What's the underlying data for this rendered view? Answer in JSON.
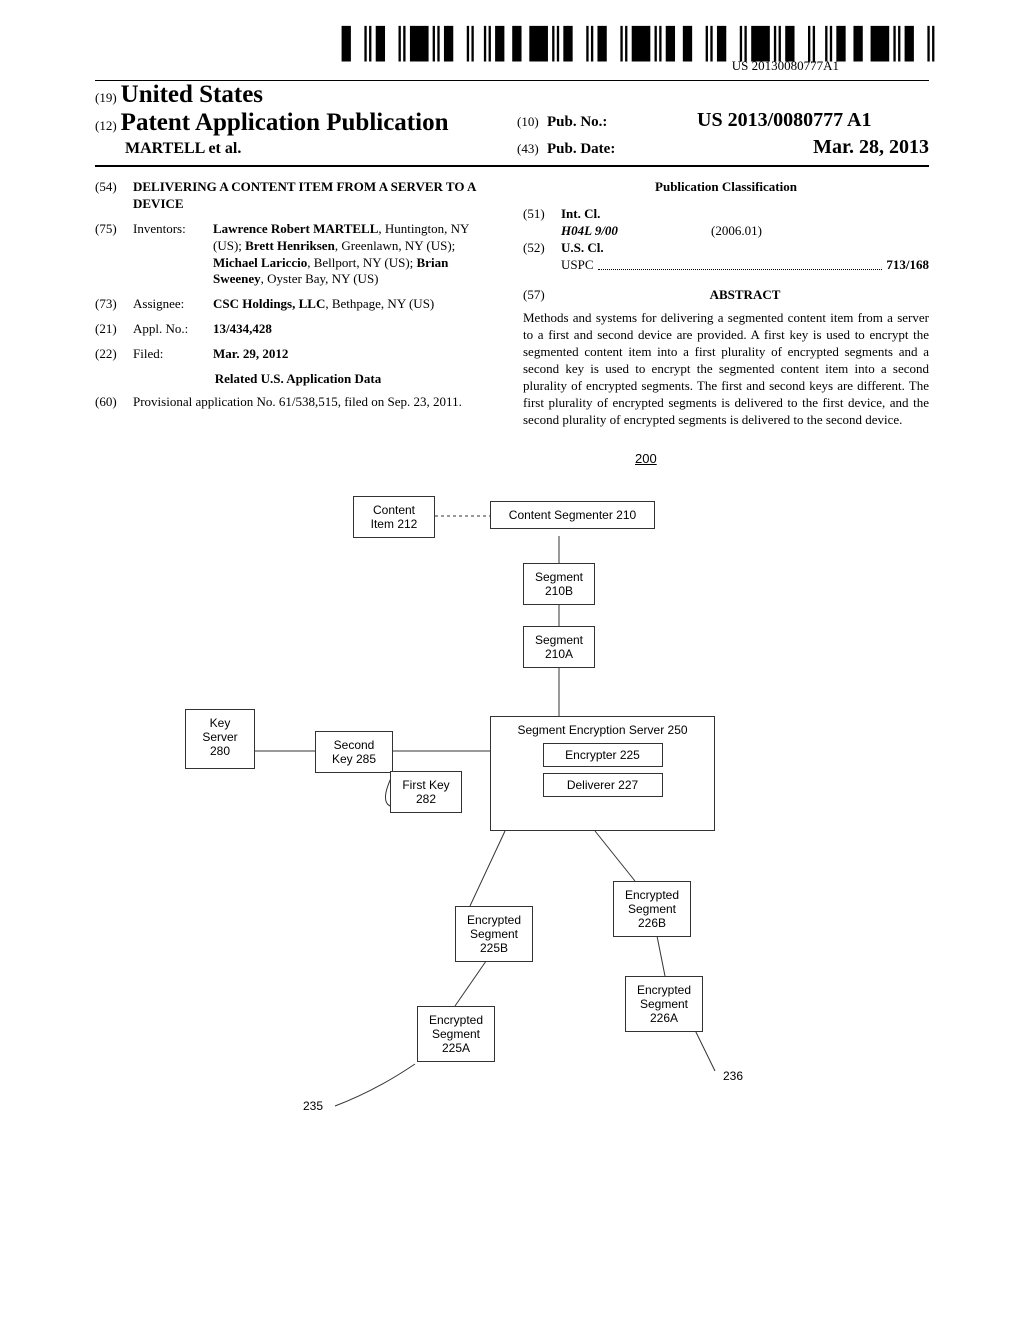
{
  "barcode_text": "US 20130080777A1",
  "header": {
    "country_num": "(19)",
    "country": "United States",
    "pub_type_num": "(12)",
    "pub_type": "Patent Application Publication",
    "authors_line": "MARTELL et al.",
    "pubno_num": "(10)",
    "pubno_label": "Pub. No.:",
    "pubno_value": "US 2013/0080777 A1",
    "pubdate_num": "(43)",
    "pubdate_label": "Pub. Date:",
    "pubdate_value": "Mar. 28, 2013"
  },
  "fields": {
    "title_num": "(54)",
    "title": "DELIVERING A CONTENT ITEM FROM A SERVER TO A DEVICE",
    "inventors_num": "(75)",
    "inventors_label": "Inventors:",
    "inventors_a": "Lawrence Robert MARTELL",
    "inventors_a_loc": ", Huntington, NY (US); ",
    "inventors_b": "Brett Henriksen",
    "inventors_b_loc": ", Greenlawn, NY (US); ",
    "inventors_c": "Michael Lariccio",
    "inventors_c_loc": ", Bellport, NY (US); ",
    "inventors_d": "Brian Sweeney",
    "inventors_d_loc": ", Oyster Bay, NY (US)",
    "assignee_num": "(73)",
    "assignee_label": "Assignee:",
    "assignee_name": "CSC Holdings, LLC",
    "assignee_loc": ", Bethpage, NY (US)",
    "appl_num_num": "(21)",
    "appl_num_label": "Appl. No.:",
    "appl_num_value": "13/434,428",
    "filed_num": "(22)",
    "filed_label": "Filed:",
    "filed_value": "Mar. 29, 2012",
    "related_heading": "Related U.S. Application Data",
    "provisional_num": "(60)",
    "provisional_text": "Provisional application No. 61/538,515, filed on Sep. 23, 2011."
  },
  "classification": {
    "heading": "Publication Classification",
    "intcl_num": "(51)",
    "intcl_label": "Int. Cl.",
    "intcl_code": "H04L 9/00",
    "intcl_year": "(2006.01)",
    "uscl_num": "(52)",
    "uscl_label": "U.S. Cl.",
    "uscl_uspc": "USPC",
    "uscl_value": "713/168"
  },
  "abstract": {
    "num": "(57)",
    "label": "ABSTRACT",
    "text": "Methods and systems for delivering a segmented content item from a server to a first and second device are provided. A first key is used to encrypt the segmented content item into a first plurality of encrypted segments and a second key is used to encrypt the segmented content item into a second plurality of encrypted segments. The first and second keys are different. The first plurality of encrypted segments is delivered to the first device, and the second plurality of encrypted segments is delivered to the second device."
  },
  "figure": {
    "ref": "200",
    "content_item": "Content Item 212",
    "content_segmenter": "Content Segmenter 210",
    "segment_b": "Segment 210B",
    "segment_a": "Segment 210A",
    "key_server": "Key Server 280",
    "second_key": "Second Key 285",
    "first_key": "First Key 282",
    "seg_enc_server": "Segment Encryption Server 250",
    "encrypter": "Encrypter 225",
    "deliverer": "Deliverer 227",
    "enc_seg_226b": "Encrypted Segment 226B",
    "enc_seg_225b": "Encrypted Segment 225B",
    "enc_seg_226a": "Encrypted Segment 226A",
    "enc_seg_225a": "Encrypted Segment 225A",
    "ref235": "235",
    "ref236": "236"
  }
}
